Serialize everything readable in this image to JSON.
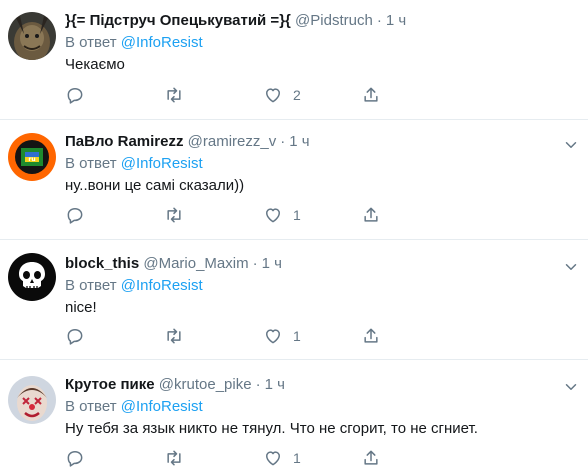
{
  "reply_prefix": "В ответ",
  "tweets": [
    {
      "name": "}{= Підструч Опецькуватий =}{",
      "handle": "@Pidstruch",
      "time": "1 ч",
      "reply_to": "@InfoResist",
      "text": "Чекаємо",
      "likes": "2",
      "avatar": "dark-creature-avatar"
    },
    {
      "name": "ПаВло Ramirezz",
      "handle": "@ramirezz_v",
      "time": "1 ч",
      "reply_to": "@InfoResist",
      "text": "ну..вони це самі сказали))",
      "likes": "1",
      "avatar": "orange-ring-flag-avatar"
    },
    {
      "name": "block_this",
      "handle": "@Mario_Maxim",
      "time": "1 ч",
      "reply_to": "@InfoResist",
      "text": "nice!",
      "likes": "1",
      "avatar": "skull-avatar"
    },
    {
      "name": "Крутое пике",
      "handle": "@krutoe_pike",
      "time": "1 ч",
      "reply_to": "@InfoResist",
      "text": "Ну тебя за язык никто не тянул. Что не сгорит, то не сгниет.",
      "likes": "1",
      "avatar": "clown-face-avatar"
    }
  ]
}
